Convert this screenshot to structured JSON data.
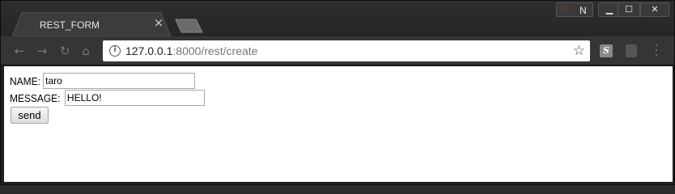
{
  "browser": {
    "tab_title": "REST_FORM",
    "url_host": "127.0.0.1",
    "url_rest": ":8000/rest/create",
    "extension_badge": "N",
    "extension_s": "S"
  },
  "form": {
    "name_label": "NAME:",
    "name_value": "taro",
    "message_label": "MESSAGE:",
    "message_value": "HELLO!",
    "send_label": "send"
  },
  "icons": [
    "back-icon",
    "forward-icon",
    "reload-icon",
    "home-icon",
    "info-icon",
    "star-icon",
    "menu-icon",
    "tab-close-icon"
  ]
}
